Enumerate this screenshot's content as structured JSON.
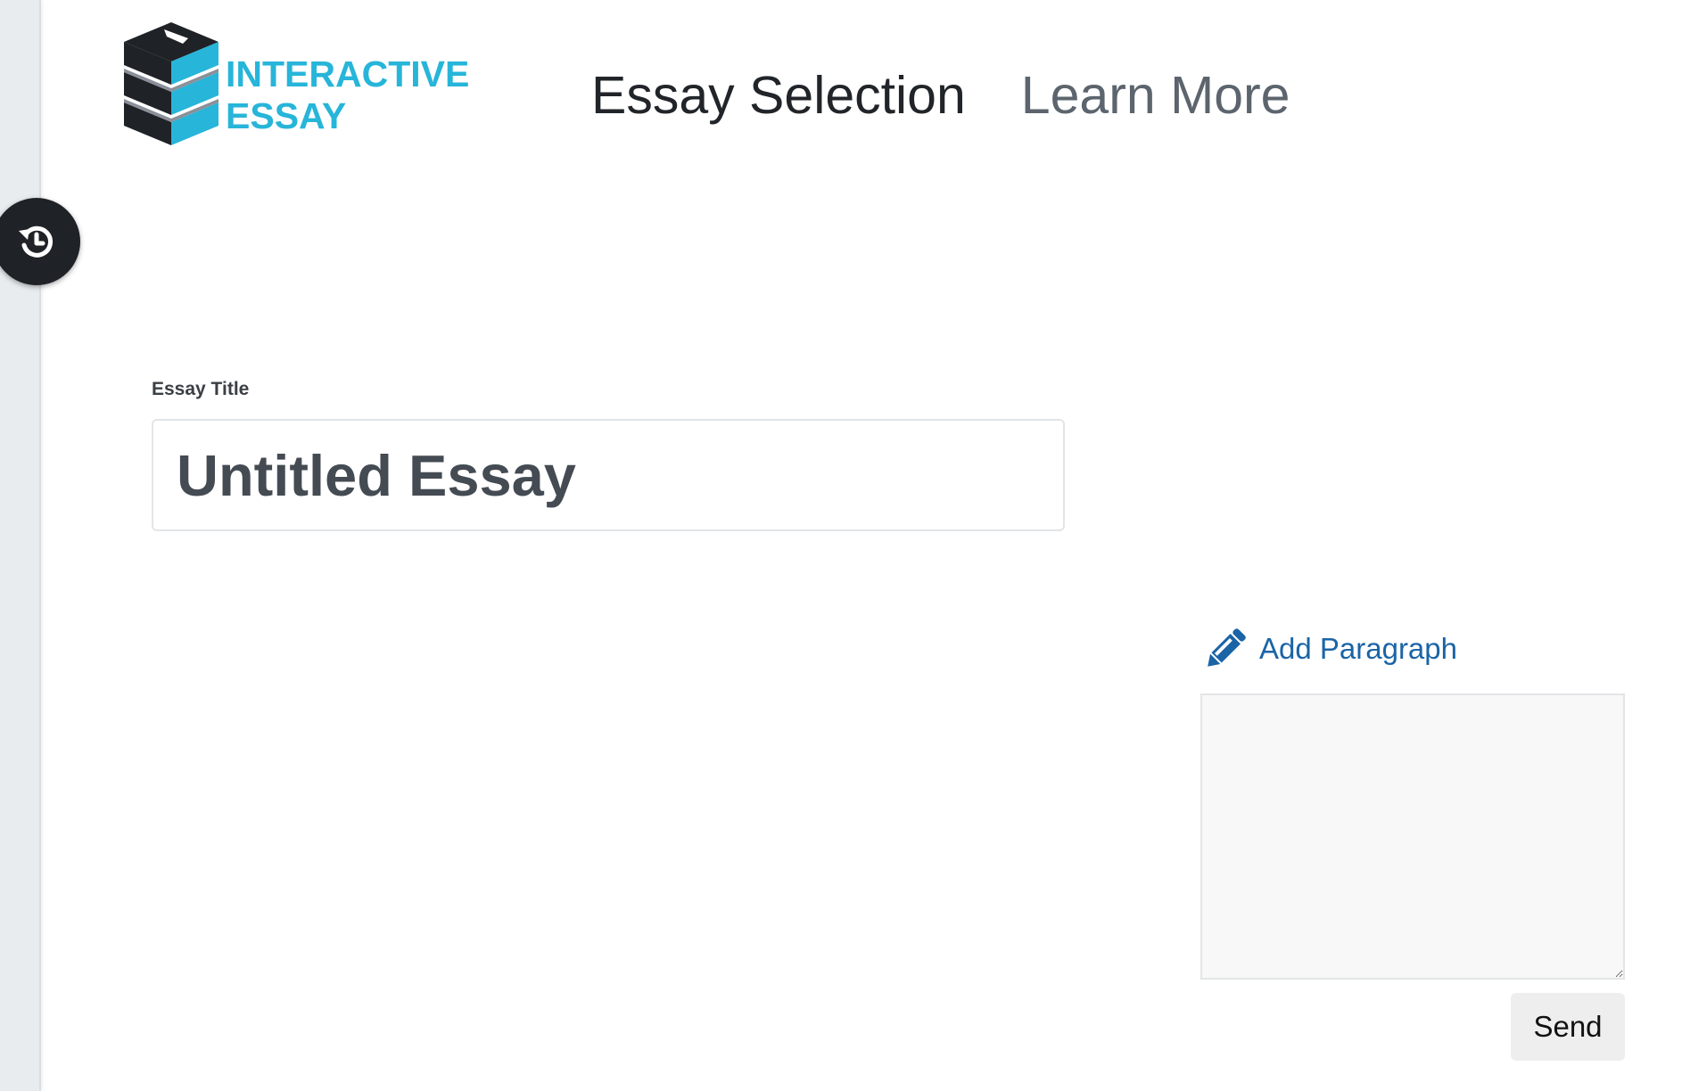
{
  "logo": {
    "line1": "INTERACTIVE",
    "line2": "ESSAY",
    "icon": "stacked-books-icon",
    "color": "#27b5d9"
  },
  "nav": {
    "items": [
      {
        "label": "Essay Selection",
        "state": "active"
      },
      {
        "label": "Learn More",
        "state": "inactive"
      }
    ]
  },
  "history_button": {
    "icon": "history-restore-icon"
  },
  "essay": {
    "title_label": "Essay Title",
    "title_value": "Untitled Essay"
  },
  "paragraph": {
    "add_label": "Add Paragraph",
    "add_icon": "pencil-icon",
    "textarea_value": "",
    "send_label": "Send"
  },
  "colors": {
    "link_blue": "#1b64a6",
    "nav_active": "#212529",
    "nav_muted": "#5c646d"
  }
}
